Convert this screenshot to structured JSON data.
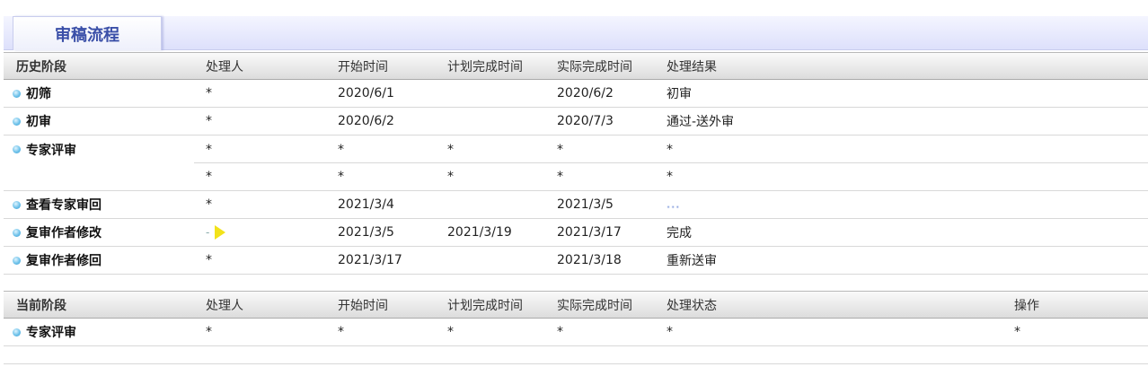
{
  "tab": {
    "title": "审稿流程"
  },
  "history": {
    "headers": {
      "stage": "历史阶段",
      "handler": "处理人",
      "start": "开始时间",
      "plan": "计划完成时间",
      "actual": "实际完成时间",
      "result": "处理结果"
    },
    "rows": [
      {
        "stage": "初筛",
        "handler": "*",
        "start": "2020/6/1",
        "plan": "",
        "actual": "2020/6/2",
        "result": "初审"
      },
      {
        "stage": "初审",
        "handler": "*",
        "start": "2020/6/2",
        "plan": "",
        "actual": "2020/7/3",
        "result": "通过-送外审"
      },
      {
        "stage": "专家评审",
        "handler": "*",
        "start": "*",
        "plan": "*",
        "actual": "*",
        "result": "*"
      },
      {
        "stage": "",
        "handler": "*",
        "start": "*",
        "plan": "*",
        "actual": "*",
        "result": "*"
      },
      {
        "stage": "查看专家审回",
        "handler": "*",
        "start": "2021/3/4",
        "plan": "",
        "actual": "2021/3/5",
        "result": "..."
      },
      {
        "stage": "复审作者修改",
        "handler": "-",
        "start": "2021/3/5",
        "plan": "2021/3/19",
        "actual": "2021/3/17",
        "result": "完成"
      },
      {
        "stage": "复审作者修回",
        "handler": "*",
        "start": "2021/3/17",
        "plan": "",
        "actual": "2021/3/18",
        "result": "重新送审"
      }
    ]
  },
  "current": {
    "headers": {
      "stage": "当前阶段",
      "handler": "处理人",
      "start": "开始时间",
      "plan": "计划完成时间",
      "actual": "实际完成时间",
      "status": "处理状态",
      "op": "操作"
    },
    "rows": [
      {
        "stage": "专家评审",
        "handler": "*",
        "start": "*",
        "plan": "*",
        "actual": "*",
        "status": "*",
        "op": "*"
      }
    ]
  },
  "colors": {
    "tab_text": "#3a4fa8",
    "dot": "#6ec2ea",
    "header_bg": "#dcdcdc"
  }
}
